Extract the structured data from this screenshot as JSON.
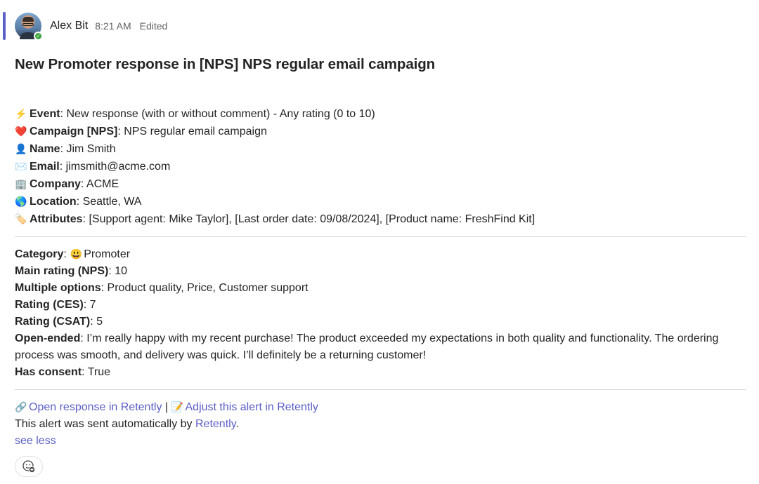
{
  "message": {
    "author": "Alex Bit",
    "time": "8:21 AM",
    "status": "Edited",
    "accent_color": "#5b5fc7",
    "presence": "available",
    "title": "New Promoter response in [NPS] NPS regular email campaign"
  },
  "details": [
    {
      "icon": "lightning-icon",
      "glyph": "⚡",
      "label": "Event",
      "value": "New response (with or without comment) - Any rating (0 to 10)"
    },
    {
      "icon": "heart-icon",
      "glyph": "❤️",
      "label": "Campaign [NPS]",
      "value": "NPS regular email campaign"
    },
    {
      "icon": "person-icon",
      "glyph": "👤",
      "label": "Name",
      "value": "Jim Smith"
    },
    {
      "icon": "envelope-icon",
      "glyph": "✉️",
      "label": "Email",
      "value": "jimsmith@acme.com"
    },
    {
      "icon": "office-building-icon",
      "glyph": "🏢",
      "label": "Company",
      "value": "ACME"
    },
    {
      "icon": "globe-icon",
      "glyph": "🌎",
      "label": "Location",
      "value": "Seattle, WA"
    },
    {
      "icon": "label-tag-icon",
      "glyph": "🏷️",
      "label": "Attributes",
      "value": "[Support agent: Mike Taylor], [Last order date: 09/08/2024], [Product name: FreshFind Kit]"
    }
  ],
  "response": {
    "category_label": "Category",
    "category_glyph": "😃",
    "category_value": "Promoter",
    "nps_label": "Main rating (NPS)",
    "nps_value": "10",
    "options_label": "Multiple options",
    "options_value": "Product quality, Price, Customer support",
    "ces_label": "Rating (CES)",
    "ces_value": "7",
    "csat_label": "Rating (CSAT)",
    "csat_value": "5",
    "open_label": "Open-ended",
    "open_value": "I’m really happy with my recent purchase! The product exceeded my expectations in both quality and functionality. The ordering process was smooth, and delivery was quick. I’ll definitely be a returning customer!",
    "consent_label": "Has consent",
    "consent_value": "True"
  },
  "footer": {
    "link_glyph": "🔗",
    "open_link": "Open response in Retently",
    "separator": " | ",
    "memo_glyph": "📝",
    "adjust_link": "Adjust this alert in Retently",
    "sent_text": "This alert was sent automatically by ",
    "retently_link": "Retently",
    "period": ".",
    "see_less": "see less"
  },
  "reaction": {
    "glyph": "☺"
  }
}
